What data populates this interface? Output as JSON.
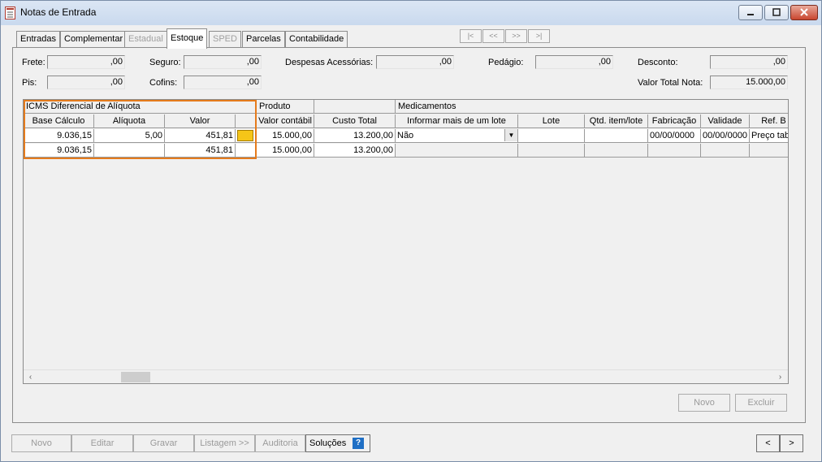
{
  "window": {
    "title": "Notas de Entrada"
  },
  "tabs": [
    {
      "label": "Entradas"
    },
    {
      "label": "Complementar"
    },
    {
      "label": "Estadual"
    },
    {
      "label": "Estoque"
    },
    {
      "label": "SPED"
    },
    {
      "label": "Parcelas"
    },
    {
      "label": "Contabilidade"
    }
  ],
  "nav": {
    "first": "|<",
    "prev": "<<",
    "next": ">>",
    "last": ">|"
  },
  "fields": {
    "frete": {
      "label": "Frete:",
      "value": ",00"
    },
    "seguro": {
      "label": "Seguro:",
      "value": ",00"
    },
    "despesas": {
      "label": "Despesas Acessórias:",
      "value": ",00"
    },
    "pedagio": {
      "label": "Pedágio:",
      "value": ",00"
    },
    "desconto": {
      "label": "Desconto:",
      "value": ",00"
    },
    "pis": {
      "label": "Pis:",
      "value": ",00"
    },
    "cofins": {
      "label": "Cofins:",
      "value": ",00"
    },
    "valor_total": {
      "label": "Valor Total Nota:",
      "value": "15.000,00"
    }
  },
  "grid": {
    "groups": {
      "icms": "ICMS Diferencial de Alíquota",
      "produto": "Produto",
      "medicamentos": "Medicamentos"
    },
    "columns": [
      "Base Cálculo",
      "Alíquota",
      "Valor",
      "",
      "Valor contábil",
      "Custo Total",
      "Informar mais de um lote",
      "Lote",
      "Qtd. item/lote",
      "Fabricação",
      "Validade",
      "Ref. B"
    ],
    "rows": [
      {
        "base": "9.036,15",
        "aliquota": "5,00",
        "valor": "451,81",
        "valor_contabil": "15.000,00",
        "custo_total": "13.200,00",
        "informar_lote": "Não",
        "lote": "",
        "qtd": "",
        "fabricacao": "00/00/0000",
        "validade": "00/00/0000",
        "ref": "Preço tab"
      },
      {
        "base": "9.036,15",
        "aliquota": "",
        "valor": "451,81",
        "valor_contabil": "15.000,00",
        "custo_total": "13.200,00",
        "informar_lote": "",
        "lote": "",
        "qtd": "",
        "fabricacao": "",
        "validade": "",
        "ref": ""
      }
    ]
  },
  "panel_buttons": {
    "novo": "Novo",
    "excluir": "Excluir"
  },
  "bottom_buttons": {
    "novo": "Novo",
    "editar": "Editar",
    "gravar": "Gravar",
    "listagem": "Listagem >>",
    "auditoria": "Auditoria",
    "solucoes": "Soluções",
    "prev": "<",
    "next": ">"
  },
  "colors": {
    "highlight": "#e57b1c",
    "help": "#1f6fc5"
  }
}
